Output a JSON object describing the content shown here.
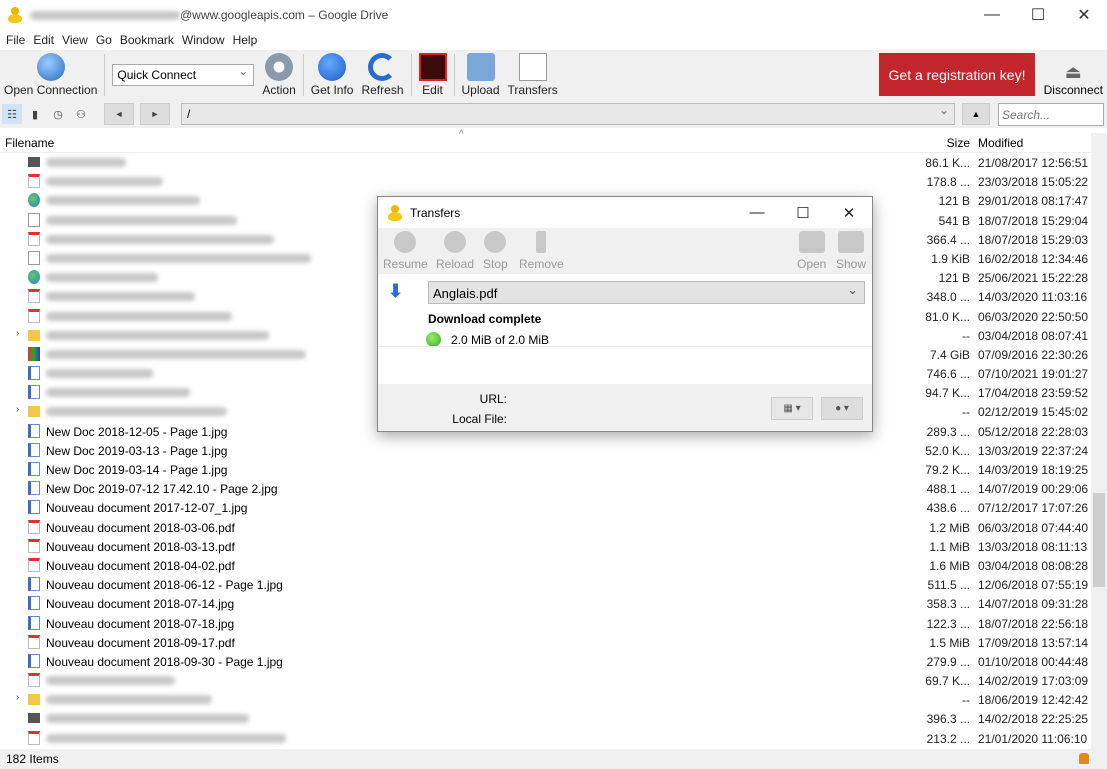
{
  "window": {
    "title_suffix": "@www.googleapis.com – Google Drive",
    "min": "—",
    "max": "☐",
    "close": "✕"
  },
  "menu": [
    "File",
    "Edit",
    "View",
    "Go",
    "Bookmark",
    "Window",
    "Help"
  ],
  "toolbar": {
    "open_connection": "Open Connection",
    "quick_connect": "Quick Connect",
    "action": "Action",
    "get_info": "Get Info",
    "refresh": "Refresh",
    "edit": "Edit",
    "upload": "Upload",
    "transfers": "Transfers",
    "register": "Get a registration key!",
    "disconnect": "Disconnect"
  },
  "nav": {
    "path": "/",
    "search_placeholder": "Search...",
    "back": "◄",
    "forward": "►",
    "up": "▲"
  },
  "columns": {
    "filename": "Filename",
    "size": "Size",
    "modified": "Modified"
  },
  "files": [
    {
      "icon": "trm",
      "name": "",
      "size": "86.1 K...",
      "modified": "21/08/2017 12:56:51"
    },
    {
      "icon": "pdf",
      "name": "",
      "size": "178.8 ...",
      "modified": "23/03/2018 15:05:22"
    },
    {
      "icon": "glb",
      "name": "",
      "size": "121 B",
      "modified": "29/01/2018 08:17:47"
    },
    {
      "icon": "doc",
      "name": "",
      "size": "541 B",
      "modified": "18/07/2018 15:29:04"
    },
    {
      "icon": "pdf",
      "name": "",
      "size": "366.4 ...",
      "modified": "18/07/2018 15:29:03"
    },
    {
      "icon": "doc",
      "name": "",
      "size": "1.9 KiB",
      "modified": "16/02/2018 12:34:46"
    },
    {
      "icon": "glb",
      "name": "",
      "size": "121 B",
      "modified": "25/06/2021 15:22:28"
    },
    {
      "icon": "pdf",
      "name": "",
      "size": "348.0 ...",
      "modified": "14/03/2020 11:03:16"
    },
    {
      "icon": "pdf",
      "name": "",
      "size": "81.0 K...",
      "modified": "06/03/2020 22:50:50"
    },
    {
      "icon": "fld",
      "name": "",
      "size": "--",
      "modified": "03/04/2018 08:07:41",
      "folder": true
    },
    {
      "icon": "app",
      "name": "",
      "size": "7.4 GiB",
      "modified": "07/09/2016 22:30:26"
    },
    {
      "icon": "jpg",
      "name": "",
      "size": "746.6 ...",
      "modified": "07/10/2021 19:01:27"
    },
    {
      "icon": "jpg",
      "name": "",
      "size": "94.7 K...",
      "modified": "17/04/2018 23:59:52"
    },
    {
      "icon": "fld",
      "name": "",
      "size": "--",
      "modified": "02/12/2019 15:45:02",
      "folder": true
    },
    {
      "icon": "jpg",
      "name": "New Doc 2018-12-05 - Page 1.jpg",
      "size": "289.3 ...",
      "modified": "05/12/2018 22:28:03"
    },
    {
      "icon": "jpg",
      "name": "New Doc 2019-03-13 - Page 1.jpg",
      "size": "52.0 K...",
      "modified": "13/03/2019 22:37:24"
    },
    {
      "icon": "jpg",
      "name": "New Doc 2019-03-14 - Page 1.jpg",
      "size": "79.2 K...",
      "modified": "14/03/2019 18:19:25"
    },
    {
      "icon": "jpg",
      "name": "New Doc 2019-07-12 17.42.10 - Page 2.jpg",
      "size": "488.1 ...",
      "modified": "14/07/2019 00:29:06"
    },
    {
      "icon": "jpg",
      "name": "Nouveau document 2017-12-07_1.jpg",
      "size": "438.6 ...",
      "modified": "07/12/2017 17:07:26"
    },
    {
      "icon": "pdf",
      "name": "Nouveau document 2018-03-06.pdf",
      "size": "1.2 MiB",
      "modified": "06/03/2018 07:44:40"
    },
    {
      "icon": "pdf",
      "name": "Nouveau document 2018-03-13.pdf",
      "size": "1.1 MiB",
      "modified": "13/03/2018 08:11:13"
    },
    {
      "icon": "pdf",
      "name": "Nouveau document 2018-04-02.pdf",
      "size": "1.6 MiB",
      "modified": "03/04/2018 08:08:28"
    },
    {
      "icon": "jpg",
      "name": "Nouveau document 2018-06-12 - Page 1.jpg",
      "size": "511.5 ...",
      "modified": "12/06/2018 07:55:19"
    },
    {
      "icon": "jpg",
      "name": "Nouveau document 2018-07-14.jpg",
      "size": "358.3 ...",
      "modified": "14/07/2018 09:31:28"
    },
    {
      "icon": "jpg",
      "name": "Nouveau document 2018-07-18.jpg",
      "size": "122.3 ...",
      "modified": "18/07/2018 22:56:18"
    },
    {
      "icon": "pdf",
      "name": "Nouveau document 2018-09-17.pdf",
      "size": "1.5 MiB",
      "modified": "17/09/2018 13:57:14"
    },
    {
      "icon": "jpg",
      "name": "Nouveau document 2018-09-30 - Page 1.jpg",
      "size": "279.9 ...",
      "modified": "01/10/2018 00:44:48"
    },
    {
      "icon": "pdf",
      "name": "",
      "size": "69.7 K...",
      "modified": "14/02/2019 17:03:09"
    },
    {
      "icon": "fld",
      "name": "",
      "size": "--",
      "modified": "18/06/2019 12:42:42",
      "folder": true
    },
    {
      "icon": "trm",
      "name": "",
      "size": "396.3 ...",
      "modified": "14/02/2018 22:25:25"
    },
    {
      "icon": "pdf",
      "name": "",
      "size": "213.2 ...",
      "modified": "21/01/2020 11:06:10"
    }
  ],
  "status": {
    "items": "182 Items"
  },
  "transfers": {
    "title": "Transfers",
    "resume": "Resume",
    "reload": "Reload",
    "stop": "Stop",
    "remove": "Remove",
    "open": "Open",
    "show": "Show",
    "file": "Anglais.pdf",
    "status": "Download complete",
    "progress": "2.0 MiB of 2.0 MiB",
    "progress_percent": 100,
    "url_label": "URL:",
    "local_label": "Local File:"
  },
  "colors": {
    "register_bg": "#c4262e",
    "complete": "#3a3"
  }
}
